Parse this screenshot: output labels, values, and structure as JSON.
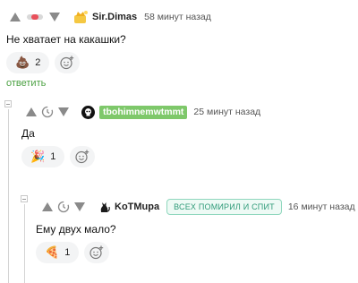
{
  "comments": [
    {
      "author": "Sir.Dimas",
      "time": "58 минут назад",
      "text": "Не хватает на какашки?",
      "reaction_emoji": "💩",
      "reaction_count": "2",
      "reply_label": "ответить",
      "avatar_icon": "crown-avatar-icon"
    },
    {
      "author": "tbohimnemwtmmt",
      "time": "25 минут назад",
      "text": "Да",
      "reaction_emoji": "🎉",
      "reaction_count": "1",
      "avatar_icon": "skull-avatar-icon"
    },
    {
      "author": "KoTMupa",
      "badge": "ВСЕХ ПОМИРИЛ И СПИТ",
      "time": "16 минут назад",
      "text": "Ему двух мало?",
      "reaction_emoji": "🍕",
      "reaction_count": "1",
      "avatar_icon": "cat-avatar-icon"
    }
  ],
  "colors": {
    "accent_green": "#4ca143",
    "badge_green": "#7ec86a",
    "badge_outline_text": "#2e9a78",
    "rating_red": "#e8505b"
  }
}
